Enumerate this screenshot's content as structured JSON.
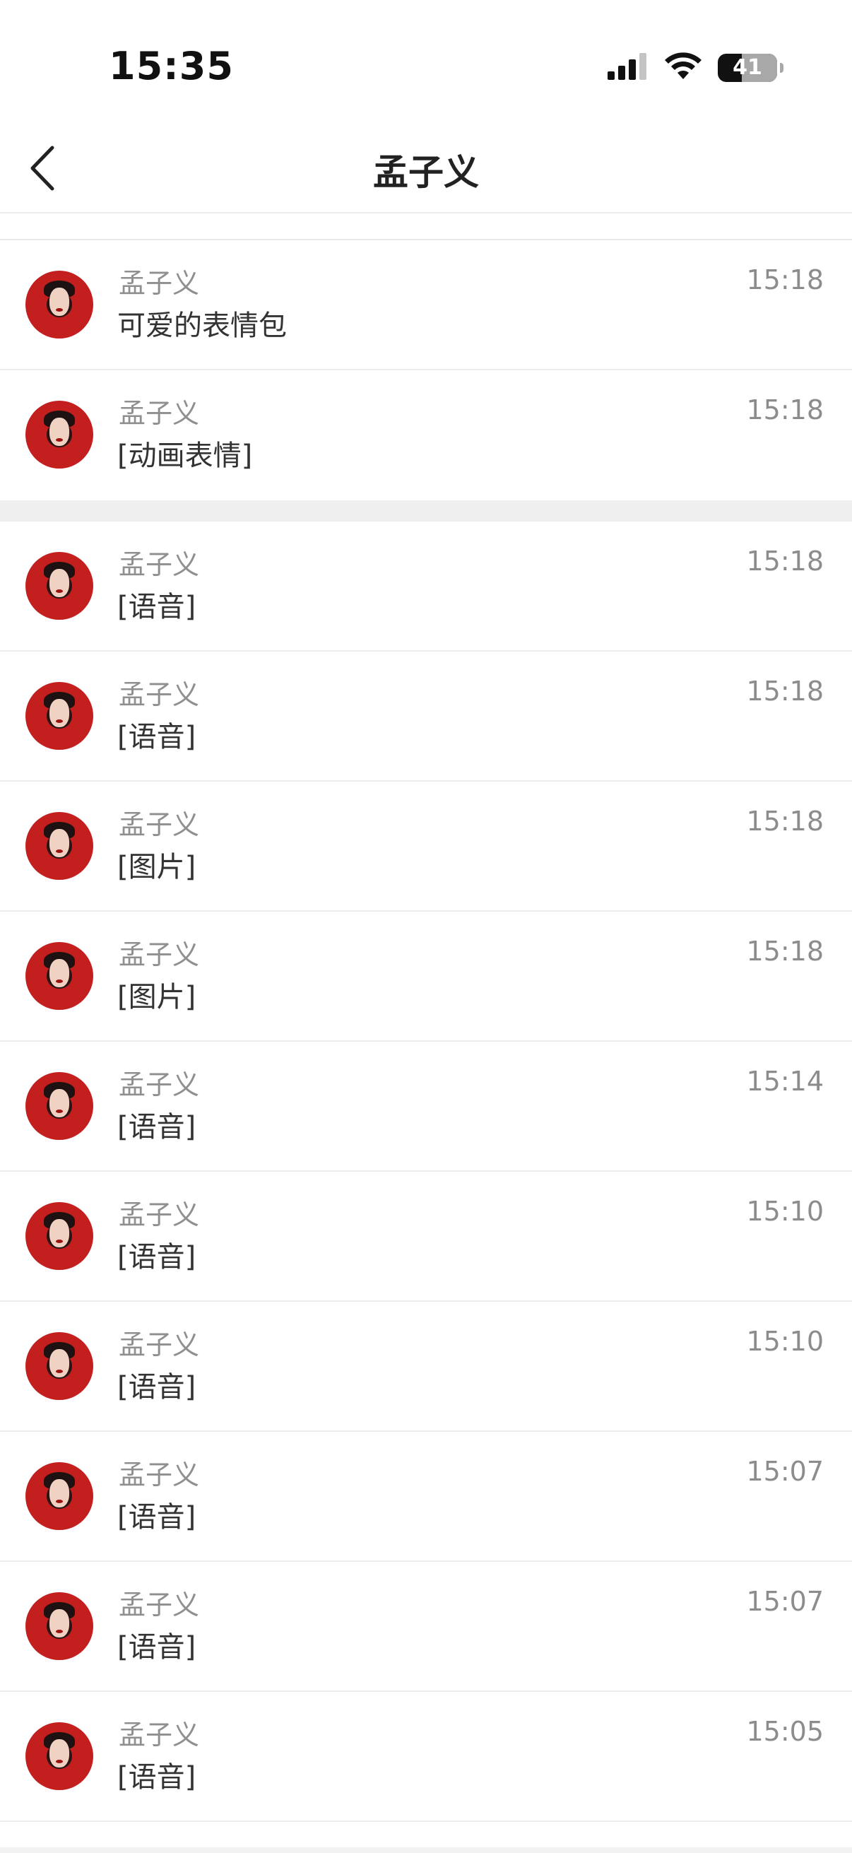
{
  "status_bar": {
    "time": "15:35",
    "battery": "41",
    "battery_level": 0.41
  },
  "nav": {
    "title": "孟子义"
  },
  "messages": [
    {
      "sender": "孟子义",
      "text": "可爱的表情包",
      "time": "15:18"
    },
    {
      "sender": "孟子义",
      "text": "[动画表情]",
      "time": "15:18"
    },
    {
      "sender": "孟子义",
      "text": "[语音]",
      "time": "15:18"
    },
    {
      "sender": "孟子义",
      "text": "[语音]",
      "time": "15:18"
    },
    {
      "sender": "孟子义",
      "text": "[图片]",
      "time": "15:18"
    },
    {
      "sender": "孟子义",
      "text": "[图片]",
      "time": "15:18"
    },
    {
      "sender": "孟子义",
      "text": "[语音]",
      "time": "15:14"
    },
    {
      "sender": "孟子义",
      "text": "[语音]",
      "time": "15:10"
    },
    {
      "sender": "孟子义",
      "text": "[语音]",
      "time": "15:10"
    },
    {
      "sender": "孟子义",
      "text": "[语音]",
      "time": "15:07"
    },
    {
      "sender": "孟子义",
      "text": "[语音]",
      "time": "15:07"
    },
    {
      "sender": "孟子义",
      "text": "[语音]",
      "time": "15:05"
    }
  ],
  "icons": {
    "back": "chevron-left-icon",
    "signal": "cellular-signal-icon",
    "wifi": "wifi-icon",
    "battery": "battery-icon"
  },
  "colors": {
    "avatar_red": "#c41f1f",
    "secondary_text": "#8f8f8f"
  }
}
